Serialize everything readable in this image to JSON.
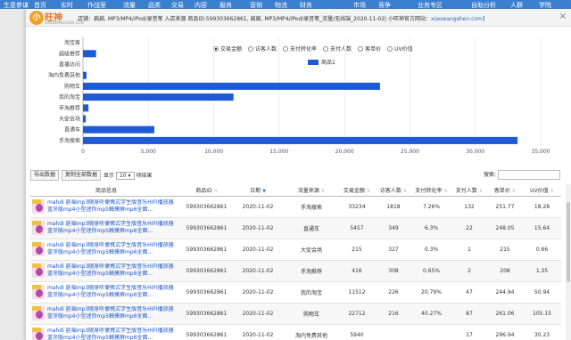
{
  "topnav": [
    "生意参谋",
    "首页",
    "实时",
    "作战室",
    "流量",
    "品类",
    "交易",
    "内容",
    "服务",
    "营销",
    "物流",
    "财务",
    "",
    "市场",
    "竞争",
    "业务专区",
    "",
    "自助分析",
    "人群",
    "学院"
  ],
  "logo": {
    "circle": "小",
    "name": "旺神",
    "sub": "XIAOWANGSHEN.COM"
  },
  "shopinfo": {
    "text": "店铺：扁扁, MP3/MP4/iPod/录音笔 入店来源 商品ID:599303662861, 扁扁, MP3/MP4/iPod/录音笔_流量/无线端_2020-11-02| 小旺神官方网站：",
    "link": "xiaowangshen.com",
    "end": "]"
  },
  "close": "×",
  "radios": [
    "交易金额",
    "访客人数",
    "支付转化率",
    "支付人数",
    "客单价",
    "UV价值"
  ],
  "legend_label": "商品1",
  "chart_data": {
    "type": "bar",
    "orientation": "horizontal",
    "categories": [
      "淘宝客",
      "超级推荐",
      "直播访问",
      "淘内免费其他",
      "购物车",
      "我的淘宝",
      "手淘推荐",
      "大促会场",
      "直通车",
      "手淘搜索"
    ],
    "series": [
      {
        "name": "商品1",
        "values": [
          0,
          1000,
          0,
          270,
          22712,
          11512,
          416,
          215,
          5457,
          33234
        ],
        "color": "#1e5ad6"
      }
    ],
    "xlim": [
      0,
      35000
    ],
    "xticks": [
      "0",
      "5,000",
      "10,000",
      "15,000",
      "20,000",
      "25,000",
      "30,000",
      "35,000"
    ],
    "grid": true
  },
  "controls": {
    "export": "导出数据",
    "copy": "复制全部数据",
    "show": "显示",
    "count": "10",
    "unit": "项结果",
    "search": "搜索:"
  },
  "table": {
    "headers": [
      "商品信息",
      "商品ID",
      "日期",
      "流量来源",
      "交易金额",
      "访客人数",
      "支付转化率",
      "支付人数",
      "客单价",
      "UV价值"
    ],
    "rows": [
      {
        "product": "mahdi 延福mp3随身听便携式学生版音乐HIFI播放器蓝牙版mp4小型迷你mp5触摸屏mp6全面...",
        "id": "599303662861",
        "date": "2020-11-02",
        "source": "手淘搜索",
        "amount": "33234",
        "visitors": "1818",
        "rate": "7.26%",
        "buyers": "132",
        "price": "251.77",
        "uv": "18.28"
      },
      {
        "product": "mahdi 延福mp3随身听便携式学生版音乐HIFI播放器蓝牙版mp4小型迷你mp5触摸屏mp6全面...",
        "id": "599303662861",
        "date": "2020-11-02",
        "source": "直通车",
        "amount": "5457",
        "visitors": "349",
        "rate": "6.3%",
        "buyers": "22",
        "price": "248.05",
        "uv": "15.64"
      },
      {
        "product": "mahdi 延福mp3随身听便携式学生版音乐HIFI播放器蓝牙版mp4小型迷你mp5触摸屏mp6全面...",
        "id": "599303662861",
        "date": "2020-11-02",
        "source": "大促会场",
        "amount": "215",
        "visitors": "327",
        "rate": "0.3%",
        "buyers": "1",
        "price": "215",
        "uv": "0.66"
      },
      {
        "product": "mahdi 延福mp3随身听便携式学生版音乐HIFI播放器蓝牙版mp4小型迷你mp5触摸屏mp6全面...",
        "id": "599303662861",
        "date": "2020-11-02",
        "source": "手淘推荐",
        "amount": "416",
        "visitors": "308",
        "rate": "0.65%",
        "buyers": "2",
        "price": "208",
        "uv": "1.35"
      },
      {
        "product": "mahdi 延福mp3随身听便携式学生版音乐HIFI播放器蓝牙版mp4小型迷你mp5触摸屏mp6全面...",
        "id": "599303662861",
        "date": "2020-11-02",
        "source": "我的淘宝",
        "amount": "11512",
        "visitors": "226",
        "rate": "20.79%",
        "buyers": "47",
        "price": "244.94",
        "uv": "50.94"
      },
      {
        "product": "mahdi 延福mp3随身听便携式学生版音乐HIFI播放器蓝牙版mp4小型迷你mp5触摸屏mp6全面...",
        "id": "599303662861",
        "date": "2020-11-02",
        "source": "购物车",
        "amount": "22712",
        "visitors": "216",
        "rate": "40.27%",
        "buyers": "87",
        "price": "261.06",
        "uv": "105.15"
      },
      {
        "product": "mahdi 延福mp3随身听便携式学生版音乐HIFI播放器蓝牙版mp4小型迷你mp5触摸屏mp6全面...",
        "id": "599303662861",
        "date": "2020-11-02",
        "source": "淘内免费其他",
        "amount": "5940",
        "visitors": "",
        "rate": "",
        "buyers": "17",
        "price": "296.94",
        "uv": "30.23"
      }
    ]
  }
}
